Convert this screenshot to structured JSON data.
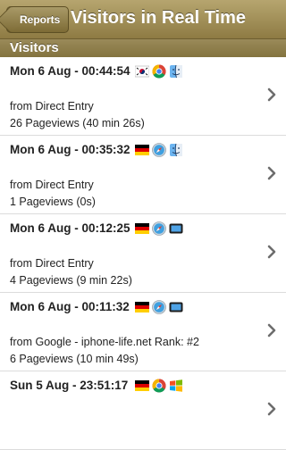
{
  "navbar": {
    "back_label": "Reports",
    "title": "Visitors in Real Time"
  },
  "section": {
    "label": "Visitors"
  },
  "visitors": [
    {
      "time": "Mon 6 Aug - 00:44:54",
      "source": "from Direct Entry",
      "pageviews": "26 Pageviews (40 min 26s)",
      "icons": [
        "flag-south-korea-icon",
        "chrome-browser-icon",
        "mac-finder-icon"
      ]
    },
    {
      "time": "Mon 6 Aug - 00:35:32",
      "source": "from Direct Entry",
      "pageviews": "1 Pageviews (0s)",
      "icons": [
        "flag-germany-icon",
        "safari-browser-icon",
        "mac-finder-icon"
      ]
    },
    {
      "time": "Mon 6 Aug - 00:12:25",
      "source": "from Direct Entry",
      "pageviews": "4 Pageviews (9 min 22s)",
      "icons": [
        "flag-germany-icon",
        "safari-browser-icon",
        "ipad-device-icon"
      ]
    },
    {
      "time": "Mon 6 Aug - 00:11:32",
      "source": "from Google - iphone-life.net Rank: #2",
      "pageviews": "6 Pageviews (10 min 49s)",
      "icons": [
        "flag-germany-icon",
        "safari-browser-icon",
        "ipad-device-icon"
      ]
    },
    {
      "time": "Sun 5 Aug - 23:51:17",
      "source": "",
      "pageviews": "",
      "icons": [
        "flag-germany-icon",
        "chrome-browser-icon",
        "windows-logo-icon"
      ]
    }
  ]
}
